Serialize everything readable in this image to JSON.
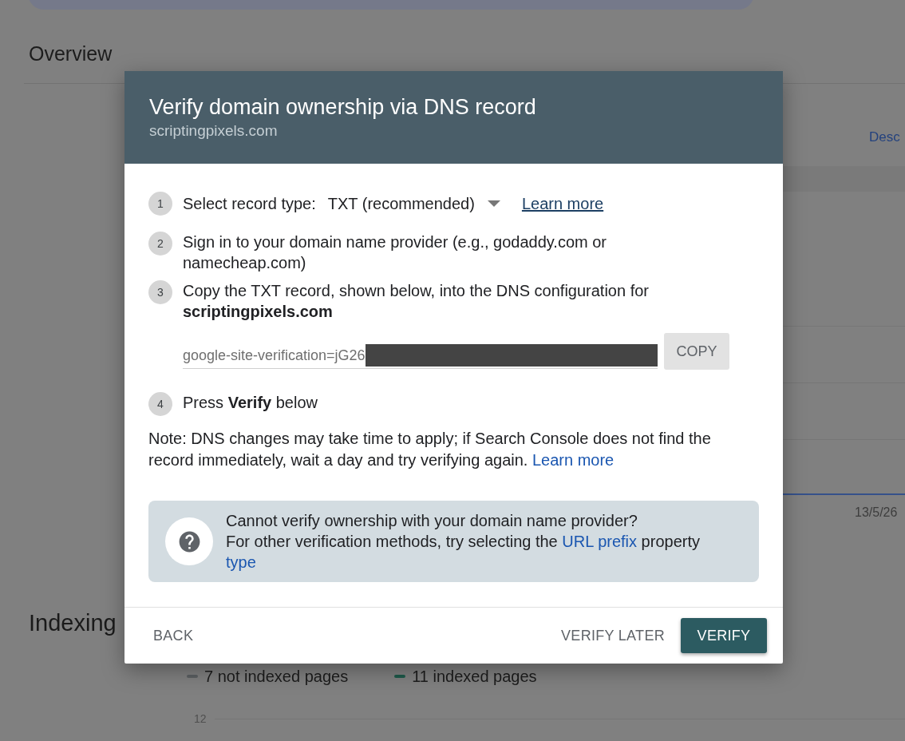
{
  "background": {
    "heading": "Overview",
    "top_right_link": "Desc",
    "date_label": "13/5/26",
    "section_heading": "Indexing",
    "legend": [
      {
        "label": "7 not indexed pages",
        "color": "#5c6063"
      },
      {
        "label": "11 indexed pages",
        "color": "#1e5a4a"
      }
    ],
    "y_tick": "12"
  },
  "dialog": {
    "title": "Verify domain ownership via DNS record",
    "subtitle": "scriptingpixels.com",
    "steps": [
      {
        "number": "1",
        "kind": "select",
        "label": "Select record type:",
        "value": "TXT (recommended)",
        "link": "Learn more"
      },
      {
        "number": "2",
        "kind": "text",
        "text": "Sign in to your domain name provider (e.g., godaddy.com or namecheap.com)"
      },
      {
        "number": "3",
        "kind": "record",
        "text": "Copy the TXT record, shown below, into the DNS configuration for **scriptingpixels.com**",
        "field": {
          "value": "google-site-verification=jG26",
          "redacted": true
        },
        "button": "COPY"
      },
      {
        "number": "4",
        "kind": "text",
        "text": "Press **Verify** below"
      }
    ],
    "note": {
      "text": "Note: DNS changes may take time to apply; if Search Console does not find the record immediately, wait a day and try verifying again.",
      "link": "Learn more"
    },
    "info": {
      "title": "Cannot verify ownership with your domain name provider?",
      "segments": [
        {
          "kind": "text",
          "text": "For other verification methods, try selecting the"
        },
        {
          "kind": "link",
          "text": "URL prefix"
        },
        {
          "kind": "text",
          "text": "property"
        },
        {
          "kind": "link",
          "text": "type"
        }
      ]
    },
    "footer": {
      "left": [
        {
          "label": "BACK",
          "kind": "text"
        }
      ],
      "right": [
        {
          "label": "VERIFY LATER",
          "kind": "text"
        },
        {
          "label": "VERIFY",
          "kind": "primary"
        }
      ]
    }
  }
}
